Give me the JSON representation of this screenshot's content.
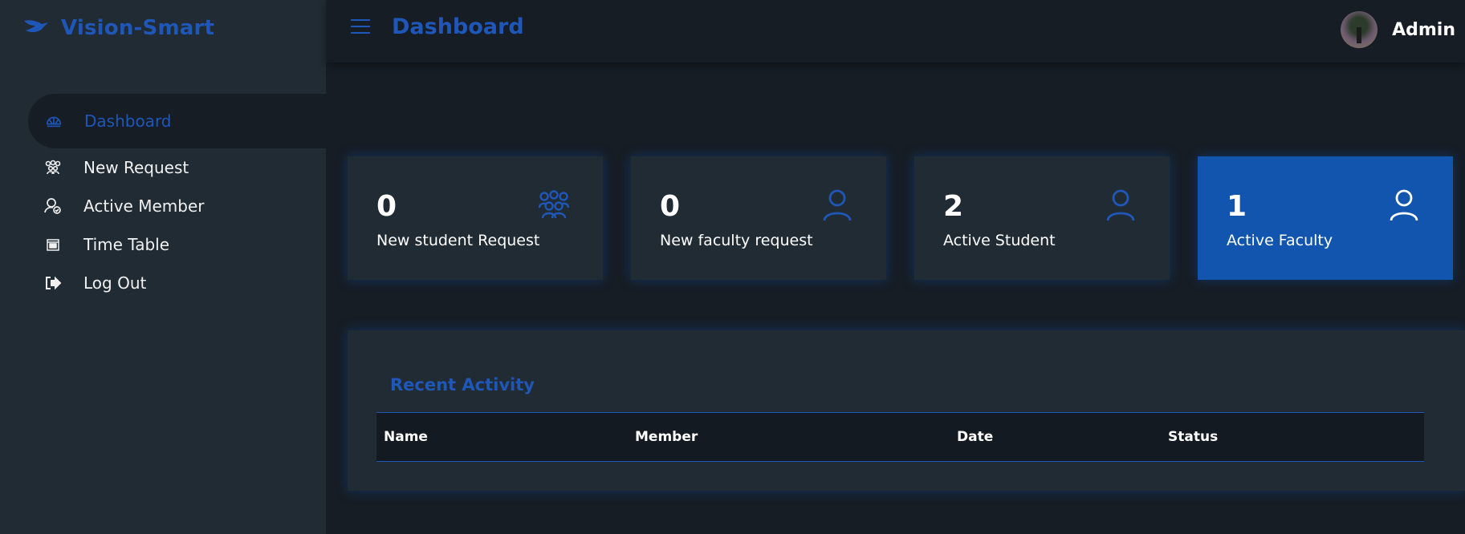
{
  "brand": {
    "name": "Vision-Smart",
    "icon": "bird-logo-icon"
  },
  "sidebar": {
    "items": [
      {
        "label": "Dashboard",
        "icon": "dashboard-icon",
        "active": true
      },
      {
        "label": "New Request",
        "icon": "users-icon"
      },
      {
        "label": "Active Member",
        "icon": "user-check-icon"
      },
      {
        "label": "Time Table",
        "icon": "calendar-icon"
      },
      {
        "label": "Log Out",
        "icon": "logout-icon"
      }
    ]
  },
  "header": {
    "menu_icon": "hamburger-menu-icon",
    "title": "Dashboard",
    "user_name": "Admin"
  },
  "cards": [
    {
      "value": "0",
      "label": "New student Request",
      "icon": "users-icon"
    },
    {
      "value": "0",
      "label": "New faculty request",
      "icon": "user-icon"
    },
    {
      "value": "2",
      "label": "Active Student",
      "icon": "user-icon"
    },
    {
      "value": "1",
      "label": "Active Faculty",
      "icon": "user-icon",
      "highlight": true
    }
  ],
  "recent_activity": {
    "title": "Recent Activity",
    "columns": [
      "Name",
      "Member",
      "Date",
      "Status"
    ],
    "rows": []
  },
  "colors": {
    "accent": "#1f57b8",
    "highlight_card": "#1155ae",
    "sidebar_bg": "#212b33",
    "main_bg": "#161d25"
  }
}
